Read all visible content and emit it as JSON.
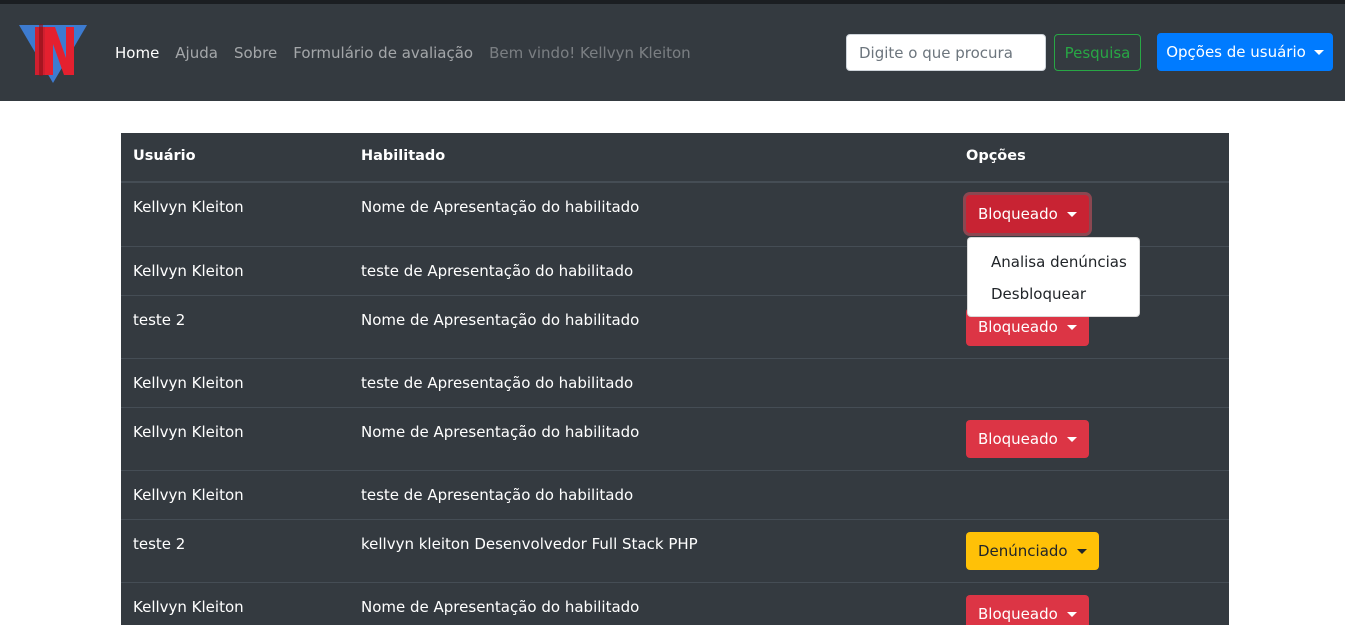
{
  "navbar": {
    "logo": "site-logo",
    "links": [
      {
        "label": "Home",
        "active": true
      },
      {
        "label": "Ajuda",
        "active": false
      },
      {
        "label": "Sobre",
        "active": false
      },
      {
        "label": "Formulário de avaliação",
        "active": false
      }
    ],
    "welcome": "Bem vindo! Kellvyn Kleiton",
    "search_placeholder": "Digite o que procura",
    "search_button": "Pesquisa",
    "user_options_button": "Opções de usuário"
  },
  "table": {
    "headers": [
      "Usuário",
      "Habilitado",
      "Opções"
    ],
    "rows": [
      {
        "user": "Kellvyn Kleiton",
        "habilitado": "Nome de Apresentação do habilitado",
        "option": "Bloqueado"
      },
      {
        "user": "Kellvyn Kleiton",
        "habilitado": "teste de Apresentação do habilitado",
        "option": ""
      },
      {
        "user": "teste 2",
        "habilitado": "Nome de Apresentação do habilitado",
        "option": "Bloqueado"
      },
      {
        "user": "Kellvyn Kleiton",
        "habilitado": "teste de Apresentação do habilitado",
        "option": ""
      },
      {
        "user": "Kellvyn Kleiton",
        "habilitado": "Nome de Apresentação do habilitado",
        "option": "Bloqueado"
      },
      {
        "user": "Kellvyn Kleiton",
        "habilitado": "teste de Apresentação do habilitado",
        "option": ""
      },
      {
        "user": "teste 2",
        "habilitado": "kellvyn kleiton Desenvolvedor Full Stack PHP",
        "option": "Denúnciado"
      },
      {
        "user": "Kellvyn Kleiton",
        "habilitado": "Nome de Apresentação do habilitado",
        "option": "Bloqueado"
      }
    ]
  },
  "dropdown": {
    "items": [
      "Analisa denúncias",
      "Desbloquear"
    ]
  },
  "colors": {
    "navbar": "#343a40",
    "danger": "#dc3545",
    "warning": "#ffc107",
    "primary": "#007bff",
    "success": "#28a745"
  }
}
